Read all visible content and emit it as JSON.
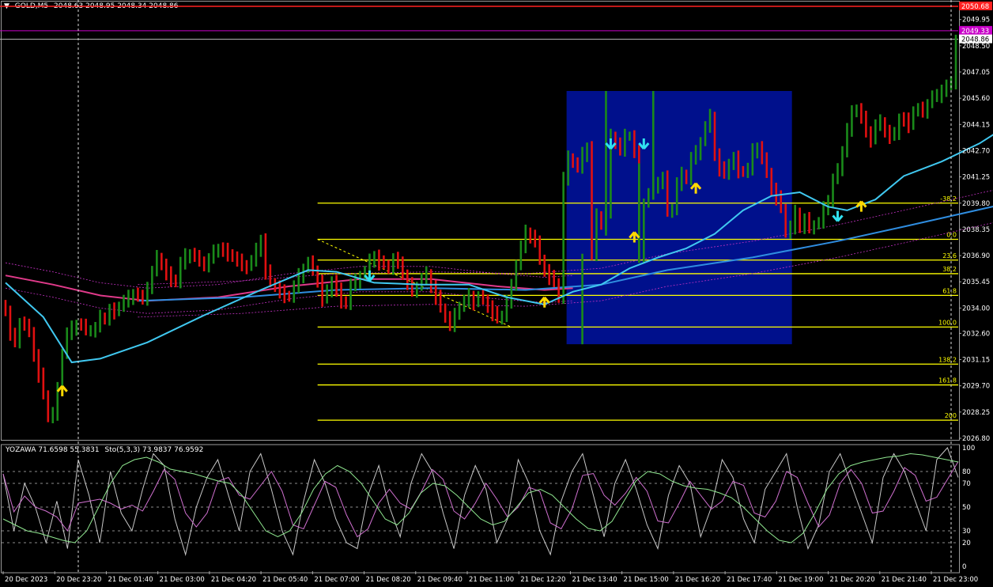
{
  "header": {
    "menu_glyph": "▼",
    "symbol": "GOLD,M5",
    "ohlc": "2048.63 2048.95 2048.34 2048.86"
  },
  "indicator_header": {
    "name": "YOZAWA 71.6598 55.3831",
    "sto": "Sto(5,3,3) 73.9837 76.9592"
  },
  "colors": {
    "background": "#000000",
    "bull_bar": "#1a8a1a",
    "bear_bar": "#e01010",
    "ma_fast": "#40c8f0",
    "ma_slow": "#2f8de0",
    "ma_magenta": "#e03a8a",
    "fib_line": "#ffff00",
    "zone_fill": "#00108c",
    "price_red": "#ff2020",
    "price_magenta": "#c800c8",
    "arrow_up": "#ffd800",
    "arrow_down": "#30e0f0",
    "sto_main": "#c8c8c8",
    "sto_signal": "#d070d0",
    "yozawa": "#90e890"
  },
  "chart_data": [
    {
      "type": "candlestick",
      "title": "GOLD,M5",
      "price_labels": [
        "2049.95",
        "2048.50",
        "2047.05",
        "2045.60",
        "2044.15",
        "2042.70",
        "2041.25",
        "2039.80",
        "2038.35",
        "2036.90",
        "2035.45",
        "2034.00",
        "2032.60",
        "2031.15",
        "2029.70",
        "2028.25",
        "2026.80"
      ],
      "ylim": [
        2026.8,
        2050.68
      ],
      "price_markers": [
        {
          "label": "2050.68",
          "value": 2050.68,
          "kind": "red"
        },
        {
          "label": "2049.33",
          "value": 2049.33,
          "kind": "magenta"
        },
        {
          "label": "2048.86",
          "value": 2048.86,
          "kind": "white"
        }
      ],
      "time_labels": [
        "20 Dec 2023",
        "20 Dec 23:20",
        "21 Dec 01:40",
        "21 Dec 03:00",
        "21 Dec 04:20",
        "21 Dec 05:40",
        "21 Dec 07:00",
        "21 Dec 08:20",
        "21 Dec 09:40",
        "21 Dec 11:00",
        "21 Dec 12:20",
        "21 Dec 13:40",
        "21 Dec 15:00",
        "21 Dec 16:20",
        "21 Dec 17:40",
        "21 Dec 19:00",
        "21 Dec 20:20",
        "21 Dec 21:40",
        "21 Dec 23:00"
      ],
      "fibonacci": [
        {
          "label": "-38.2",
          "value": 2039.8
        },
        {
          "label": "0.0",
          "value": 2037.8
        },
        {
          "label": "23.6",
          "value": 2036.65
        },
        {
          "label": "38.2",
          "value": 2035.9
        },
        {
          "label": "61.8",
          "value": 2034.7
        },
        {
          "label": "100.0",
          "value": 2032.95
        },
        {
          "label": "138.2",
          "value": 2030.9
        },
        {
          "label": "161.8",
          "value": 2029.75
        },
        {
          "label": "200",
          "value": 2027.8
        }
      ],
      "zone": {
        "price_high": 2046.0,
        "price_low": 2032.0
      },
      "closes": [
        2033.8,
        2032.5,
        2032.2,
        2033.2,
        2033.0,
        2032.7,
        2031.4,
        2030.3,
        2029.2,
        2028.0,
        2028.2,
        2029.5,
        2031.5,
        2032.6,
        2032.9,
        2033.1,
        2033.0,
        2032.8,
        2032.8,
        2032.9,
        2033.5,
        2033.4,
        2033.9,
        2033.8,
        2034.1,
        2034.4,
        2034.6,
        2034.8,
        2034.6,
        2034.5,
        2035.2,
        2036.0,
        2036.8,
        2036.4,
        2035.9,
        2035.6,
        2035.4,
        2036.5,
        2036.9,
        2037.0,
        2036.8,
        2036.6,
        2036.4,
        2036.7,
        2037.1,
        2037.3,
        2037.2,
        2037.0,
        2036.8,
        2036.6,
        2036.4,
        2036.3,
        2036.6,
        2037.2,
        2037.8,
        2036.0,
        2035.4,
        2035.2,
        2034.9,
        2034.7,
        2034.6,
        2035.2,
        2035.8,
        2036.2,
        2036.5,
        2036.1,
        2035.5,
        2034.5,
        2034.9,
        2035.5,
        2035.0,
        2034.4,
        2034.2,
        2035.3,
        2035.5,
        2035.8,
        2036.0,
        2036.6,
        2036.9,
        2036.5,
        2036.4,
        2036.2,
        2036.7,
        2036.6,
        2035.8,
        2035.3,
        2035.0,
        2035.2,
        2035.6,
        2035.9,
        2035.2,
        2034.6,
        2034.0,
        2033.5,
        2033.1,
        2033.6,
        2034.1,
        2034.4,
        2034.7,
        2034.3,
        2034.6,
        2034.5,
        2034.1,
        2033.7,
        2033.4,
        2033.6,
        2034.4,
        2035.2,
        2036.4,
        2037.4,
        2038.2,
        2038.0,
        2037.6,
        2036.7,
        2036.1,
        2035.7,
        2035.4,
        2034.6,
        2041.2,
        2042.3,
        2042.0,
        2041.8,
        2042.5,
        2042.9,
        2036.9,
        2039.1,
        2038.7,
        2039.2,
        2043.5,
        2043.1,
        2042.8,
        2043.5,
        2043.5,
        2042.6,
        2036.9,
        2039.8,
        2040.3,
        2040.7,
        2041.0,
        2041.2,
        2039.3,
        2039.5,
        2040.9,
        2041.4,
        2041.1,
        2042.3,
        2042.6,
        2043.2,
        2044.0,
        2044.6,
        2042.5,
        2041.7,
        2041.4,
        2042.0,
        2042.3,
        2041.6,
        2041.5,
        2041.7,
        2042.7,
        2042.9,
        2042.2,
        2041.5,
        2040.6,
        2040.1,
        2039.5,
        2038.2,
        2038.5,
        2039.3,
        2038.4,
        2038.9,
        2038.5,
        2038.6,
        2038.7,
        2039.5,
        2040.0,
        2041.1,
        2041.6,
        2042.7,
        2043.9,
        2044.8,
        2045.0,
        2044.5,
        2043.8,
        2043.3,
        2044.1,
        2044.3,
        2043.8,
        2043.5,
        2043.6,
        2044.5,
        2044.4,
        2044.1,
        2044.9,
        2045.0,
        2044.9,
        2045.3,
        2045.7,
        2045.7,
        2046.1,
        2046.3,
        2046.4,
        2048.86
      ],
      "ma_fast": [
        {
          "i": 0,
          "v": 2035.4
        },
        {
          "i": 8,
          "v": 2033.5
        },
        {
          "i": 14,
          "v": 2031.0
        },
        {
          "i": 20,
          "v": 2031.2
        },
        {
          "i": 30,
          "v": 2032.1
        },
        {
          "i": 42,
          "v": 2033.6
        },
        {
          "i": 54,
          "v": 2035.0
        },
        {
          "i": 64,
          "v": 2036.1
        },
        {
          "i": 70,
          "v": 2036.0
        },
        {
          "i": 78,
          "v": 2035.4
        },
        {
          "i": 88,
          "v": 2035.3
        },
        {
          "i": 98,
          "v": 2035.3
        },
        {
          "i": 106,
          "v": 2034.6
        },
        {
          "i": 114,
          "v": 2034.2
        },
        {
          "i": 120,
          "v": 2034.9
        },
        {
          "i": 126,
          "v": 2035.3
        },
        {
          "i": 132,
          "v": 2036.2
        },
        {
          "i": 138,
          "v": 2036.8
        },
        {
          "i": 144,
          "v": 2037.3
        },
        {
          "i": 150,
          "v": 2038.1
        },
        {
          "i": 156,
          "v": 2039.4
        },
        {
          "i": 162,
          "v": 2040.2
        },
        {
          "i": 168,
          "v": 2040.4
        },
        {
          "i": 174,
          "v": 2039.6
        },
        {
          "i": 178,
          "v": 2039.4
        },
        {
          "i": 184,
          "v": 2040.0
        },
        {
          "i": 190,
          "v": 2041.3
        },
        {
          "i": 198,
          "v": 2042.1
        },
        {
          "i": 206,
          "v": 2043.1
        },
        {
          "i": 212,
          "v": 2044.1
        }
      ],
      "ma_slow": [
        {
          "i": 28,
          "v": 2034.4
        },
        {
          "i": 50,
          "v": 2034.6
        },
        {
          "i": 70,
          "v": 2035.0
        },
        {
          "i": 90,
          "v": 2035.1
        },
        {
          "i": 110,
          "v": 2035.0
        },
        {
          "i": 126,
          "v": 2035.3
        },
        {
          "i": 140,
          "v": 2036.1
        },
        {
          "i": 158,
          "v": 2036.8
        },
        {
          "i": 176,
          "v": 2037.7
        },
        {
          "i": 190,
          "v": 2038.5
        },
        {
          "i": 212,
          "v": 2039.8
        }
      ],
      "ma_magenta": [
        {
          "i": 0,
          "v": 2035.8
        },
        {
          "i": 10,
          "v": 2035.3
        },
        {
          "i": 20,
          "v": 2034.7
        },
        {
          "i": 30,
          "v": 2034.4
        },
        {
          "i": 45,
          "v": 2034.6
        },
        {
          "i": 60,
          "v": 2035.2
        },
        {
          "i": 75,
          "v": 2035.6
        },
        {
          "i": 90,
          "v": 2035.6
        },
        {
          "i": 104,
          "v": 2035.2
        },
        {
          "i": 114,
          "v": 2035.0
        },
        {
          "i": 120,
          "v": 2035.1
        }
      ],
      "arrows_up": [
        {
          "i": 12,
          "v": 2029.3
        },
        {
          "i": 114,
          "v": 2034.2
        },
        {
          "i": 133,
          "v": 2037.8
        },
        {
          "i": 146,
          "v": 2040.5
        },
        {
          "i": 181,
          "v": 2039.5
        }
      ],
      "arrows_down": [
        {
          "i": 77,
          "v": 2035.9
        },
        {
          "i": 128,
          "v": 2043.2
        },
        {
          "i": 135,
          "v": 2043.2
        },
        {
          "i": 176,
          "v": 2039.2
        }
      ]
    },
    {
      "type": "line",
      "title": "YOZAWA / Sto(5,3,3)",
      "ylim": [
        0,
        100
      ],
      "levels": [
        "100",
        "80",
        "70",
        "50",
        "30",
        "20",
        "0"
      ],
      "series": [
        {
          "name": "Sto(5,3,3)",
          "values": [
            78,
            30,
            70,
            50,
            20,
            55,
            15,
            90,
            60,
            20,
            80,
            45,
            30,
            65,
            95,
            85,
            40,
            10,
            50,
            75,
            90,
            60,
            30,
            80,
            95,
            65,
            30,
            10,
            55,
            90,
            70,
            40,
            20,
            15,
            60,
            85,
            50,
            25,
            70,
            95,
            80,
            45,
            15,
            60,
            85,
            65,
            20,
            40,
            90,
            70,
            30,
            10,
            55,
            80,
            95,
            60,
            25,
            70,
            90,
            65,
            35,
            15,
            60,
            85,
            70,
            25,
            50,
            90,
            75,
            40,
            20,
            65,
            80,
            95,
            50,
            15,
            35,
            80,
            95,
            70,
            45,
            20,
            75,
            95,
            80,
            55,
            30,
            90,
            100,
            75
          ]
        },
        {
          "name": "YOZAWA",
          "values": [
            40,
            35,
            30,
            28,
            25,
            22,
            20,
            30,
            50,
            70,
            85,
            90,
            92,
            88,
            82,
            80,
            78,
            75,
            72,
            70,
            60,
            45,
            30,
            25,
            30,
            45,
            65,
            78,
            85,
            80,
            70,
            55,
            40,
            35,
            45,
            62,
            70,
            68,
            60,
            50,
            40,
            35,
            38,
            50,
            62,
            65,
            60,
            50,
            40,
            32,
            30,
            38,
            55,
            72,
            80,
            78,
            72,
            68,
            66,
            65,
            62,
            58,
            50,
            40,
            30,
            22,
            20,
            28,
            45,
            65,
            78,
            85,
            88,
            90,
            92,
            93,
            95,
            94,
            92,
            90,
            88
          ]
        }
      ]
    }
  ]
}
